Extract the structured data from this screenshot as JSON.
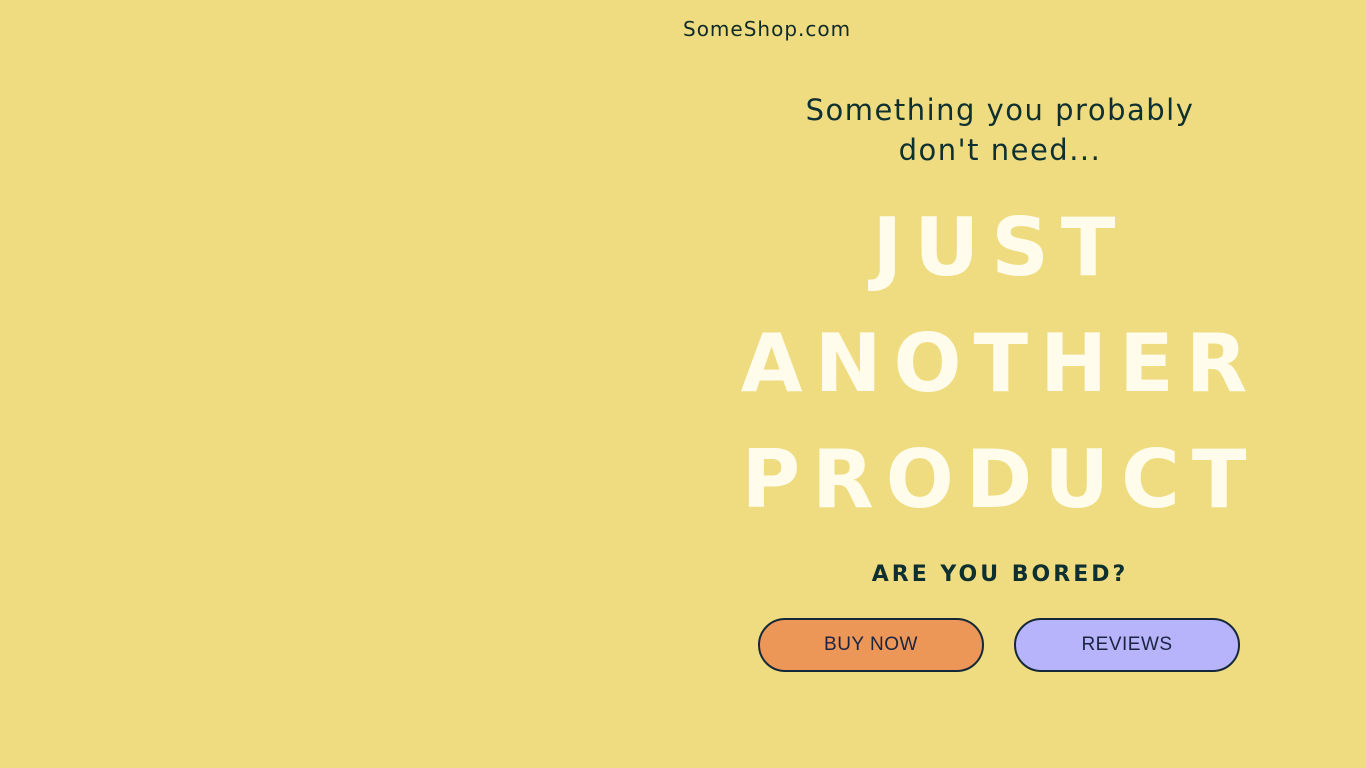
{
  "header": {
    "brand": "SomeShop.com"
  },
  "hero": {
    "tagline": "Something you probably don't need...",
    "headline": [
      "JUST",
      "ANOTHER",
      "PRODUCT"
    ],
    "subhead": "ARE YOU BORED?"
  },
  "actions": {
    "buy_label": "BUY NOW",
    "reviews_label": "REVIEWS"
  },
  "colors": {
    "background": "#F0DC80",
    "text_dark": "#0F3030",
    "headline": "#FFFCEB",
    "buy_button": "#EC9658",
    "reviews_button": "#B7B4FC"
  }
}
